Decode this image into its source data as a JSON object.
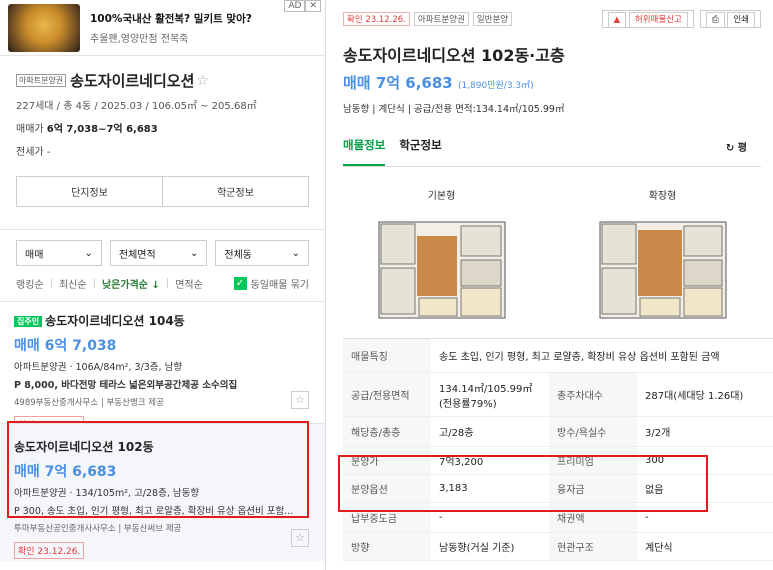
{
  "ad": {
    "title": "100%국내산 활전복? 밀키트 맞아?",
    "sub": "추울팬,영양만점 전복죽",
    "label": "AD",
    "close": "✕"
  },
  "complex": {
    "tag": "아파트분양권",
    "name": "송도자이르네디오션",
    "meta": "227세대 / 총 4동 / 2025.03 / 106.05㎡ ~ 205.68㎡",
    "sale_label": "매매가",
    "sale": "6억 7,038~7억 6,683",
    "jeonse_label": "전세가",
    "jeonse": "-",
    "btn_info": "단지정보",
    "btn_school": "학군정보"
  },
  "filters": {
    "f1": "매매",
    "f2": "전체면적",
    "f3": "전체동"
  },
  "sort": {
    "s1": "랭킹순",
    "s2": "최신순",
    "s3": "낮은가격순 ↓",
    "s4": "면적순",
    "same": "동일매물 묶기"
  },
  "item1": {
    "badge": "집주인",
    "title": "송도자이르네디오션 104동",
    "price": "매매 6억 7,038",
    "d1": "아파트분양권 · 106A/84m², 3/3층, 남향",
    "d2": "P 8,000, 바다전망 테라스 넓은외부공간제공 소수의집",
    "agent": "4989부동산중개사무소 | 부동산뱅크 제공",
    "confirm": "확인 23.12.14."
  },
  "item2": {
    "title": "송도자이르네디오션 102동",
    "price": "매매 7억 6,683",
    "d1": "아파트분양권 · 134/105m², 고/28층, 남동향",
    "d2": "P 300, 송도 초입, 인기 평형, 최고 로알층, 확장비 유상 옵션비 포함...",
    "agent": "투마부동산공인중개사사무소 | 부동산써브 제공",
    "confirm": "확인 23.12.26."
  },
  "detail": {
    "confirm": "확인 23.12.26.",
    "tag1": "아파트분양권",
    "tag2": "일반분양",
    "report": "허위매물신고",
    "print": "인쇄",
    "title": "송도자이르네디오션 102동·고층",
    "price": "매매 7억 6,683",
    "price_sub": "(1,890만원/3.3㎡)",
    "info": "남동향 | 계단식 | 공급/전용 면적:134.14㎡/105.99㎡",
    "tab1": "매물정보",
    "tab2": "학군정보",
    "sync": "평",
    "plan1": "기본형",
    "plan2": "확장형"
  },
  "table": [
    {
      "k1": "매물특징",
      "v1": "송도 초입, 인기 평형, 최고 로얄층, 확장비 유상 옵션비 포함된 금액",
      "k2": "",
      "v2": ""
    },
    {
      "k1": "공급/전용면적",
      "v1": "134.14㎡/105.99㎡ (전용률79%)",
      "k2": "총주차대수",
      "v2": "287대(세대당 1.26대)"
    },
    {
      "k1": "해당층/총층",
      "v1": "고/28층",
      "k2": "방수/욕실수",
      "v2": "3/2개"
    },
    {
      "k1": "분양가",
      "v1": "7억3,200",
      "k2": "프리미엄",
      "v2": "300"
    },
    {
      "k1": "분양옵션",
      "v1": "3,183",
      "k2": "융자금",
      "v2": "없음"
    },
    {
      "k1": "납부중도금",
      "v1": "-",
      "k2": "채권액",
      "v2": "-"
    },
    {
      "k1": "방향",
      "v1": "남동향(거실 기준)",
      "k2": "현관구조",
      "v2": "계단식"
    }
  ]
}
